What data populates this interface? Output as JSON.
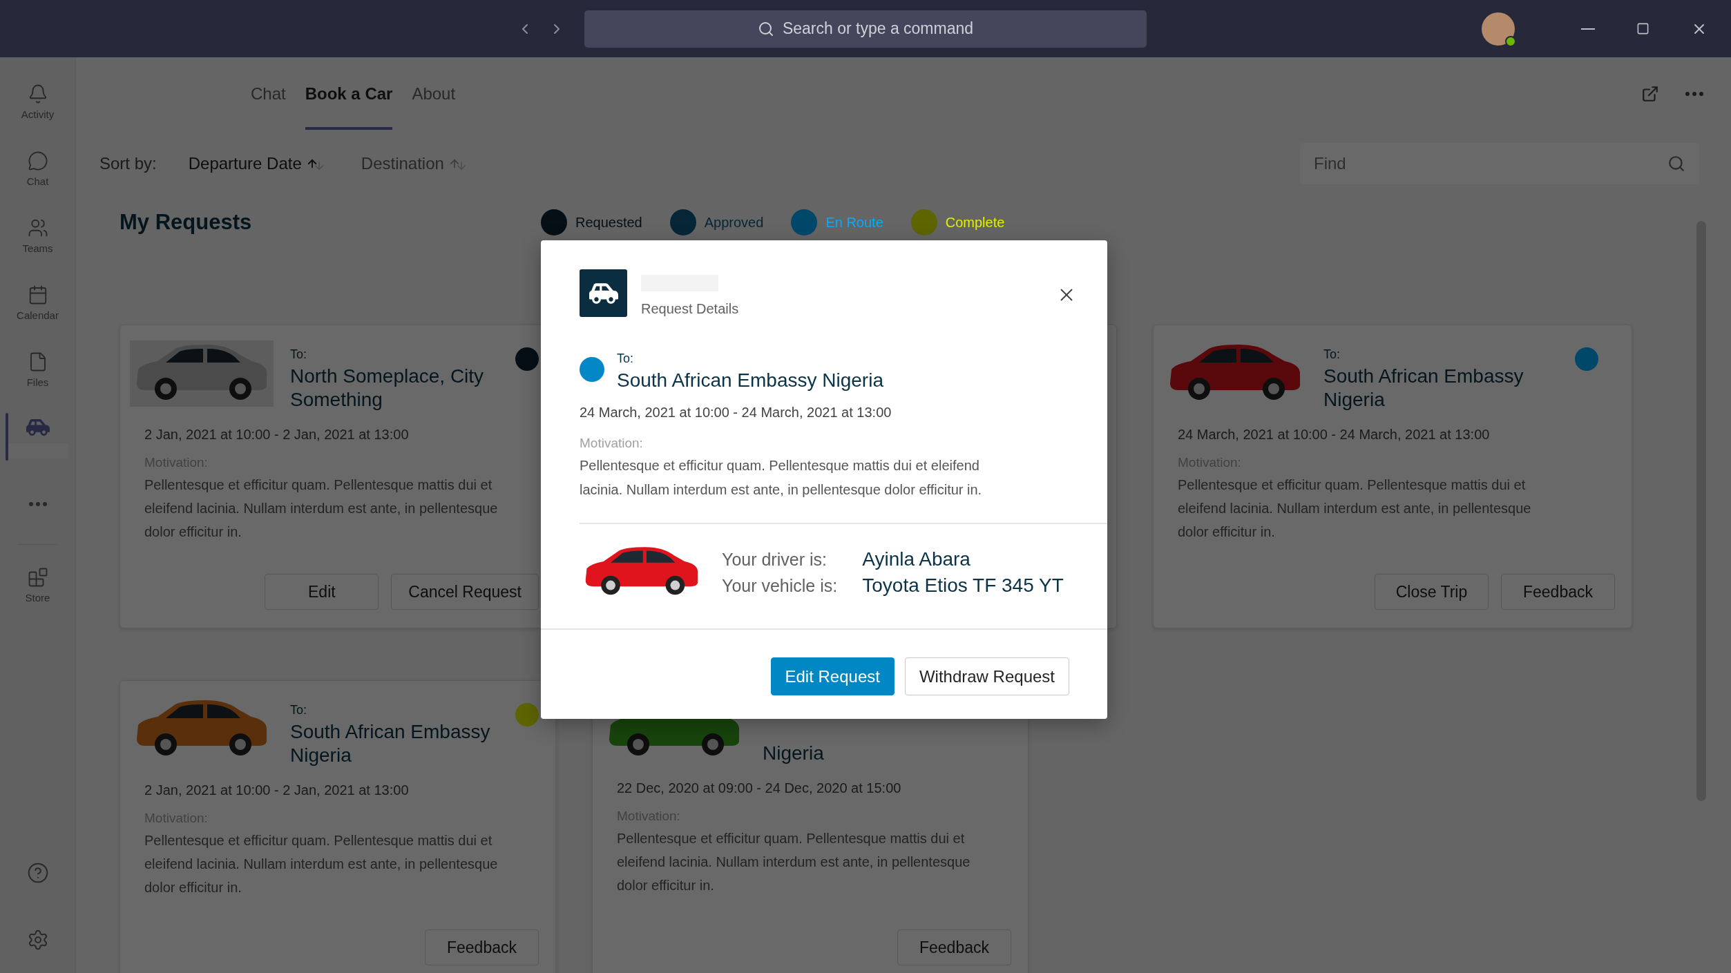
{
  "title_bar": {
    "search_placeholder": "Search or type a command"
  },
  "rail": {
    "items": [
      {
        "label": "Activity",
        "selected": false
      },
      {
        "label": "Chat",
        "selected": false
      },
      {
        "label": "Teams",
        "selected": false
      },
      {
        "label": "Calendar",
        "selected": false
      },
      {
        "label": "Files",
        "selected": false
      },
      {
        "selected": true
      }
    ],
    "lower_items": [
      {
        "label": "Store",
        "selected": false
      }
    ]
  },
  "tabs": [
    {
      "label": "Chat",
      "selected": false
    },
    {
      "label": "Book a Car",
      "selected": true
    },
    {
      "label": "About",
      "selected": false
    }
  ],
  "sort": {
    "label": "Sort by:",
    "options": [
      {
        "label": "Departure Date",
        "selected": true
      },
      {
        "label": "Destination",
        "selected": false
      }
    ]
  },
  "find": {
    "placeholder": "Find"
  },
  "requests": {
    "title": "My Requests",
    "legend": [
      {
        "label": "Requested",
        "color": "#050f15"
      },
      {
        "label": "Approved",
        "color": "#062638"
      },
      {
        "label": "En Route",
        "color": "#00486a"
      },
      {
        "label": "Complete",
        "color": "#5e6400"
      }
    ],
    "card_rows": [
      [
        {
          "kind": "full",
          "to_label": "To:",
          "title": "North Someplace, City Something",
          "color": "#050f15",
          "photo": {
            "color": "#4b4b4b"
          },
          "dates": "2 Jan, 2021 at 10:00 - 2 Jan, 2021 at 13:00",
          "motivation_label": "Motivation:",
          "motivation": "Pellentesque et efficitur quam. Pellentesque mattis dui et eleifend lacinia. Nullam interdum est ante, in pellentesque dolor efficitur in.",
          "buttons": [
            "Edit",
            "Cancel Request"
          ]
        },
        {
          "kind": "covered"
        },
        {
          "kind": "full",
          "to_label": "To:",
          "title": "South African Embassy Nigeria",
          "color": "#00486a",
          "photo": {
            "color": "#59080b"
          },
          "dates": "24 March, 2021 at 10:00 - 24 March, 2021 at 13:00",
          "motivation_label": "Motivation:",
          "motivation": "Pellentesque et efficitur quam. Pellentesque mattis dui et eleifend lacinia. Nullam interdum est ante, in pellentesque dolor efficitur in.",
          "buttons": [
            "Close Trip",
            "Feedback"
          ]
        }
      ],
      [
        {
          "kind": "full",
          "to_label": "To:",
          "title": "South African Embassy Nigeria",
          "color": "#5e6400",
          "photo": {
            "color": "#59300b"
          },
          "dates": "2 Jan, 2021 at 10:00 - 2 Jan, 2021 at 13:00",
          "motivation_label": "Motivation:",
          "motivation": "Pellentesque et efficitur quam. Pellentesque mattis dui et eleifend lacinia. Nullam interdum est ante, in pellentesque dolor efficitur in.",
          "buttons": [
            "Feedback"
          ]
        },
        {
          "kind": "full",
          "title": "Nigeria",
          "photo": {
            "color": "#18450c"
          },
          "dates": "22 Dec, 2020 at 09:00 - 24 Dec, 2020 at 15:00",
          "motivation_label": "Motivation:",
          "motivation": "Pellentesque et efficitur quam. Pellentesque mattis dui et eleifend lacinia. Nullam interdum est ante, in pellentesque dolor efficitur in.",
          "buttons": [
            "Feedback"
          ]
        }
      ]
    ]
  },
  "modal": {
    "subtitle": "Request Details",
    "to_label": "To:",
    "title": "South African Embassy Nigeria",
    "color": "#0387c6",
    "dates": "24 March, 2021 at 10:00 - 24 March, 2021 at 13:00",
    "motivation_label": "Motivation:",
    "motivation": "Pellentesque et efficitur quam. Pellentesque mattis dui et eleifend lacinia. Nullam interdum est ante, in pellentesque dolor efficitur in.",
    "photo": {
      "color": "#e0141c"
    },
    "driver_label": "Your driver is:",
    "driver": "Ayinla Abara",
    "vehicle_label": "Your vehicle is:",
    "vehicle": "Toyota Etios TF 345 YT",
    "buttons": [
      {
        "label": "Edit Request",
        "primary": true
      },
      {
        "label": "Withdraw Request",
        "primary": false
      }
    ]
  }
}
